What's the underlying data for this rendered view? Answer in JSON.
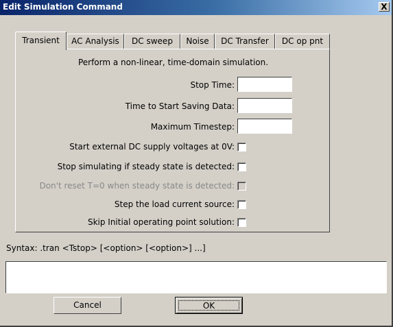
{
  "window": {
    "title": "Edit Simulation Command",
    "close_label": "X"
  },
  "tabs": [
    {
      "label": "Transient",
      "active": true
    },
    {
      "label": "AC Analysis",
      "active": false
    },
    {
      "label": "DC sweep",
      "active": false
    },
    {
      "label": "Noise",
      "active": false
    },
    {
      "label": "DC Transfer",
      "active": false
    },
    {
      "label": "DC op pnt",
      "active": false
    }
  ],
  "transient": {
    "description": "Perform a non-linear, time-domain simulation.",
    "fields": [
      {
        "label": "Stop Time:",
        "value": ""
      },
      {
        "label": "Time to Start Saving Data:",
        "value": ""
      },
      {
        "label": "Maximum Timestep:",
        "value": ""
      }
    ],
    "options": [
      {
        "label": "Start external DC supply voltages at 0V:",
        "checked": false,
        "enabled": true
      },
      {
        "label": "Stop simulating if steady state is detected:",
        "checked": false,
        "enabled": true
      },
      {
        "label": "Don't reset T=0 when steady state is detected:",
        "checked": false,
        "enabled": false
      },
      {
        "label": "Step the load current source:",
        "checked": false,
        "enabled": true
      },
      {
        "label": "Skip Initial operating point solution:",
        "checked": false,
        "enabled": true
      }
    ]
  },
  "syntax": "Syntax:  .tran <Tstop> [<option> [<option>] ...]",
  "command_text": "",
  "buttons": {
    "cancel": "Cancel",
    "ok": "OK"
  }
}
